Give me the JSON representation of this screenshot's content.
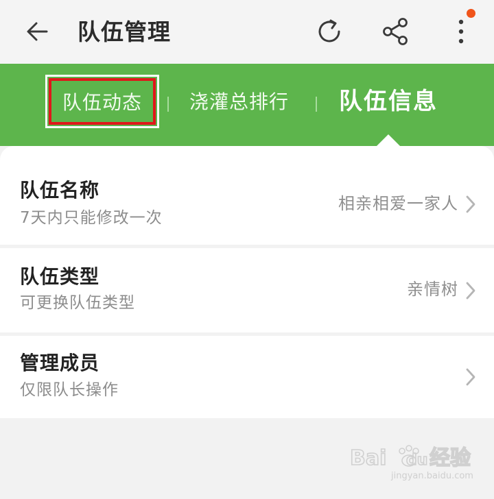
{
  "header": {
    "title": "队伍管理",
    "icons": {
      "back": "back-arrow-icon",
      "refresh": "refresh-icon",
      "share": "share-icon",
      "more": "more-vertical-icon"
    },
    "notification_dot_color": "#f0541a"
  },
  "tabs": [
    {
      "label": "队伍动态",
      "highlighted": true
    },
    {
      "label": "浇灌总排行",
      "highlighted": false
    },
    {
      "label": "队伍信息",
      "active": true
    }
  ],
  "colors": {
    "tab_bar": "#5db54c",
    "highlight_box": "#e0171b"
  },
  "rows": [
    {
      "title": "队伍名称",
      "subtitle": "7天内只能修改一次",
      "value": "相亲相爱一家人"
    },
    {
      "title": "队伍类型",
      "subtitle": "可更换队伍类型",
      "value": "亲情树"
    },
    {
      "title": "管理成员",
      "subtitle": "仅限队长操作",
      "value": ""
    }
  ],
  "watermark": {
    "text": "Bai",
    "text2": "du",
    "text3": "经验",
    "subtext": "jingyan.baidu.com"
  }
}
